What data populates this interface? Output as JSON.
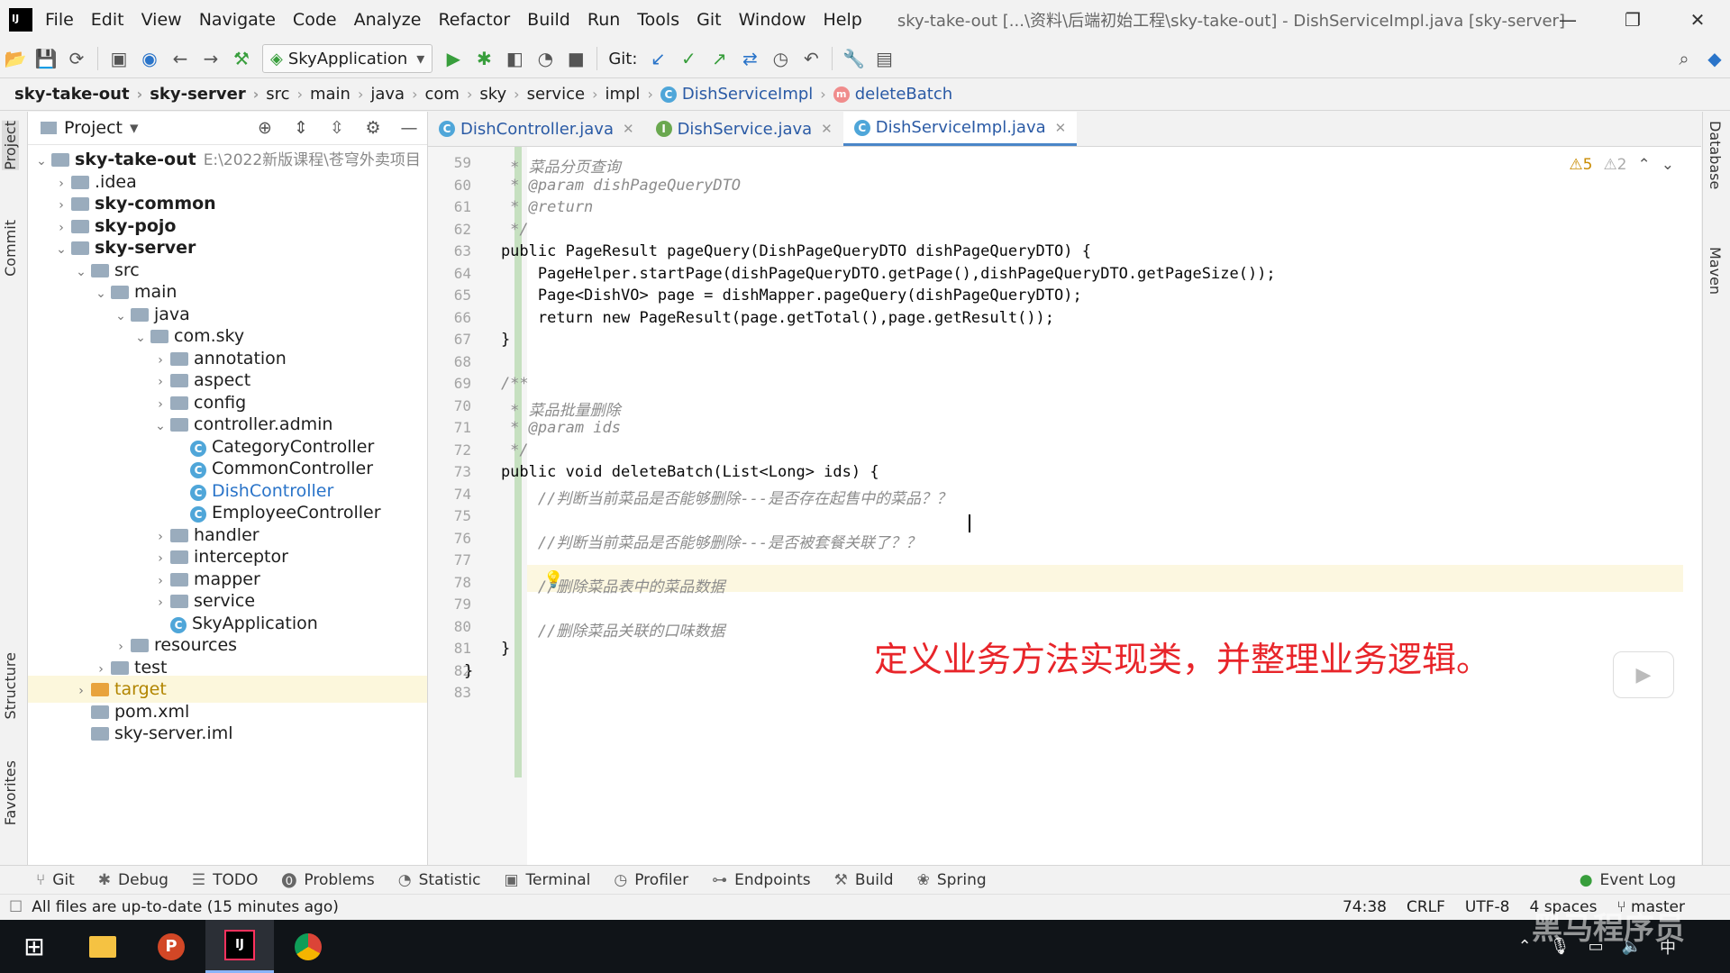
{
  "app": {
    "menu": [
      "File",
      "Edit",
      "View",
      "Navigate",
      "Code",
      "Analyze",
      "Refactor",
      "Build",
      "Run",
      "Tools",
      "Git",
      "Window",
      "Help"
    ],
    "window_title": "sky-take-out [...\\资料\\后端初始工程\\sky-take-out] - DishServiceImpl.java [sky-server]"
  },
  "toolbar": {
    "run_config": "SkyApplication",
    "git_label": "Git:"
  },
  "breadcrumb": [
    "sky-take-out",
    "sky-server",
    "src",
    "main",
    "java",
    "com",
    "sky",
    "service",
    "impl",
    "DishServiceImpl",
    "deleteBatch"
  ],
  "left_strip": [
    "Project",
    "Commit",
    "Structure",
    "Favorites"
  ],
  "right_strip": [
    "Database",
    "Maven"
  ],
  "project_panel": {
    "title": "Project",
    "root_path": "E:\\2022新版课程\\苍穹外卖项目",
    "tree": [
      {
        "label": "sky-take-out",
        "arrow": "⌄",
        "indent": 0,
        "bold": true,
        "path": true
      },
      {
        "label": ".idea",
        "arrow": "›",
        "indent": 1
      },
      {
        "label": "sky-common",
        "arrow": "›",
        "indent": 1,
        "bold": true
      },
      {
        "label": "sky-pojo",
        "arrow": "›",
        "indent": 1,
        "bold": true
      },
      {
        "label": "sky-server",
        "arrow": "⌄",
        "indent": 1,
        "bold": true
      },
      {
        "label": "src",
        "arrow": "⌄",
        "indent": 2
      },
      {
        "label": "main",
        "arrow": "⌄",
        "indent": 3
      },
      {
        "label": "java",
        "arrow": "⌄",
        "indent": 4
      },
      {
        "label": "com.sky",
        "arrow": "⌄",
        "indent": 5
      },
      {
        "label": "annotation",
        "arrow": "›",
        "indent": 6
      },
      {
        "label": "aspect",
        "arrow": "›",
        "indent": 6
      },
      {
        "label": "config",
        "arrow": "›",
        "indent": 6
      },
      {
        "label": "controller.admin",
        "arrow": "⌄",
        "indent": 6
      },
      {
        "label": "CategoryController",
        "arrow": "",
        "indent": 7,
        "cls": true
      },
      {
        "label": "CommonController",
        "arrow": "",
        "indent": 7,
        "cls": true
      },
      {
        "label": "DishController",
        "arrow": "",
        "indent": 7,
        "cls": true,
        "blue": true
      },
      {
        "label": "EmployeeController",
        "arrow": "",
        "indent": 7,
        "cls": true
      },
      {
        "label": "handler",
        "arrow": "›",
        "indent": 6
      },
      {
        "label": "interceptor",
        "arrow": "›",
        "indent": 6
      },
      {
        "label": "mapper",
        "arrow": "›",
        "indent": 6
      },
      {
        "label": "service",
        "arrow": "›",
        "indent": 6
      },
      {
        "label": "SkyApplication",
        "arrow": "",
        "indent": 6,
        "cls": true
      },
      {
        "label": "resources",
        "arrow": "›",
        "indent": 4
      },
      {
        "label": "test",
        "arrow": "›",
        "indent": 3
      },
      {
        "label": "target",
        "arrow": "›",
        "indent": 2,
        "orange": true
      },
      {
        "label": "pom.xml",
        "arrow": "",
        "indent": 2
      },
      {
        "label": "sky-server.iml",
        "arrow": "",
        "indent": 2
      }
    ]
  },
  "tabs": [
    {
      "label": "DishController.java",
      "icon": "C",
      "active": false
    },
    {
      "label": "DishService.java",
      "icon": "I",
      "active": false
    },
    {
      "label": "DishServiceImpl.java",
      "icon": "C",
      "active": true
    }
  ],
  "editor": {
    "warnings": "⚠5",
    "weak_warnings": "⚠2",
    "overlay_text": "定义业务方法实现类，并整理业务逻辑。",
    "lines": [
      {
        "n": "59",
        "t": "     * 菜品分页查询"
      },
      {
        "n": "60",
        "t": "     * @param dishPageQueryDTO"
      },
      {
        "n": "61",
        "t": "     * @return"
      },
      {
        "n": "62",
        "t": "     */"
      },
      {
        "n": "63",
        "t": "    public PageResult pageQuery(DishPageQueryDTO dishPageQueryDTO) {"
      },
      {
        "n": "64",
        "t": "        PageHelper.startPage(dishPageQueryDTO.getPage(),dishPageQueryDTO.getPageSize());"
      },
      {
        "n": "65",
        "t": "        Page<DishVO> page = dishMapper.pageQuery(dishPageQueryDTO);"
      },
      {
        "n": "66",
        "t": "        return new PageResult(page.getTotal(),page.getResult());"
      },
      {
        "n": "67",
        "t": "    }"
      },
      {
        "n": "68",
        "t": ""
      },
      {
        "n": "69",
        "t": "    /**"
      },
      {
        "n": "70",
        "t": "     * 菜品批量删除"
      },
      {
        "n": "71",
        "t": "     * @param ids"
      },
      {
        "n": "72",
        "t": "     */"
      },
      {
        "n": "73",
        "t": "    public void deleteBatch(List<Long> ids) {"
      },
      {
        "n": "74",
        "t": "        //判断当前菜品是否能够删除---是否存在起售中的菜品？？"
      },
      {
        "n": "75",
        "t": ""
      },
      {
        "n": "76",
        "t": "        //判断当前菜品是否能够删除---是否被套餐关联了？？"
      },
      {
        "n": "77",
        "t": ""
      },
      {
        "n": "78",
        "t": "        //删除菜品表中的菜品数据"
      },
      {
        "n": "79",
        "t": ""
      },
      {
        "n": "80",
        "t": "        //删除菜品关联的口味数据"
      },
      {
        "n": "81",
        "t": "    }"
      },
      {
        "n": "82",
        "t": "}"
      },
      {
        "n": "83",
        "t": ""
      }
    ]
  },
  "bottom_tools": [
    "Git",
    "Debug",
    "TODO",
    "Problems",
    "Statistic",
    "Terminal",
    "Profiler",
    "Endpoints",
    "Build",
    "Spring"
  ],
  "event_log": "Event Log",
  "status": {
    "message": "All files are up-to-date (15 minutes ago)",
    "position": "74:38",
    "line_sep": "CRLF",
    "encoding": "UTF-8",
    "indent": "4 spaces",
    "branch": "master"
  },
  "taskbar": {
    "watermark": "黑马程序员",
    "ime": "中"
  }
}
